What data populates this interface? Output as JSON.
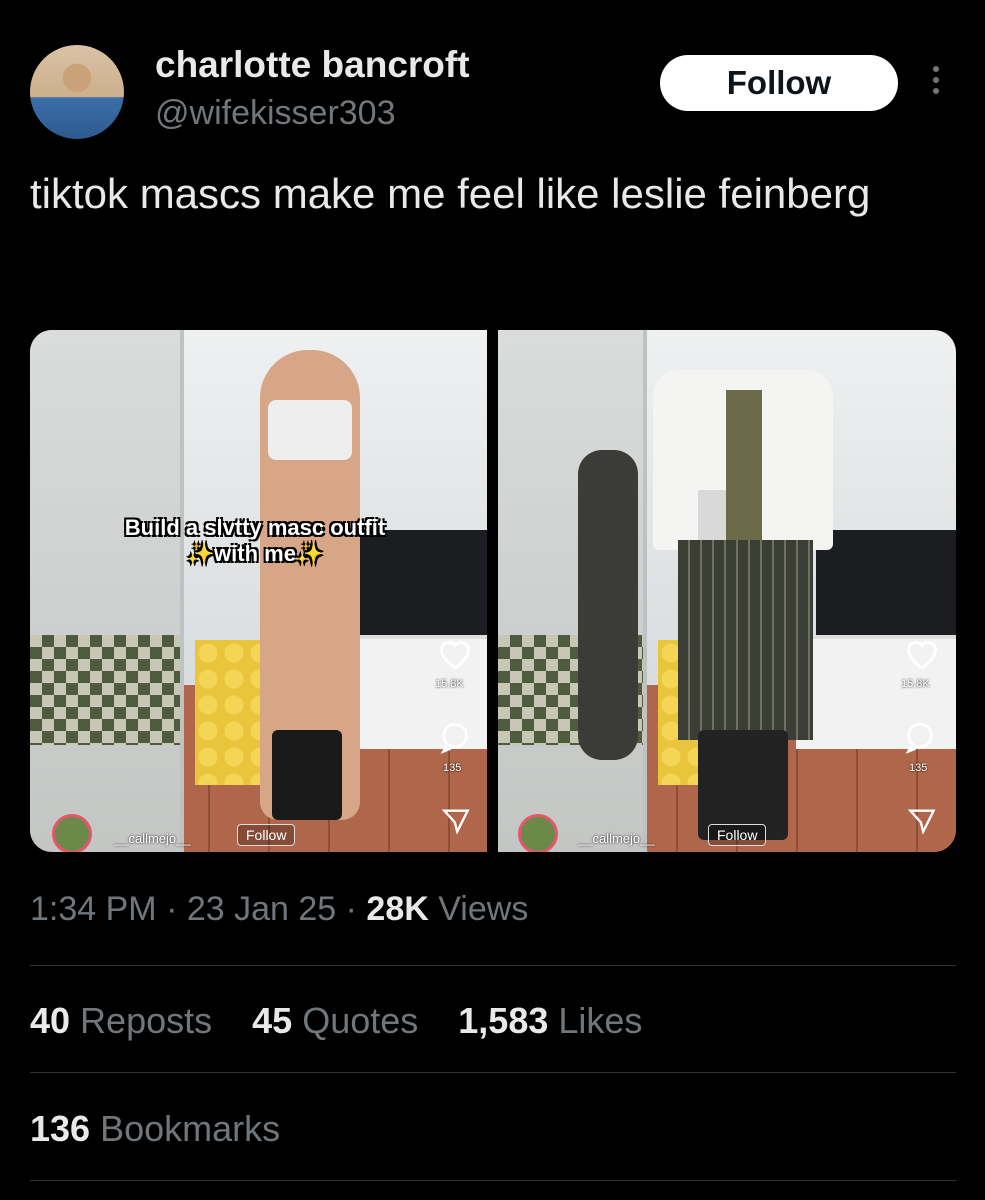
{
  "author": {
    "display_name": "charlotte bancroft",
    "handle": "@wifekisser303",
    "follow_label": "Follow"
  },
  "tweet": {
    "text": "tiktok mascs make me feel like leslie feinberg"
  },
  "media": [
    {
      "overlay_line1": "Build a slvtty masc outfit",
      "overlay_line2": "✨with me✨",
      "likes": "15.8K",
      "comments": "135",
      "username": "__callmejo__",
      "follow_label": "Follow"
    },
    {
      "likes": "15.8K",
      "comments": "135",
      "username": "__callmejo__",
      "follow_label": "Follow"
    }
  ],
  "meta": {
    "time": "1:34 PM",
    "sep1": " · ",
    "date": "23 Jan 25",
    "sep2": " · ",
    "views_count": "28K",
    "views_label": " Views"
  },
  "stats": {
    "reposts_count": "40",
    "reposts_label": " Reposts",
    "quotes_count": "45",
    "quotes_label": " Quotes",
    "likes_count": "1,583",
    "likes_label": " Likes",
    "bookmarks_count": "136",
    "bookmarks_label": " Bookmarks"
  },
  "colors": {
    "background": "#000000",
    "primary_text": "#e7e9ea",
    "secondary_text": "#71767b",
    "divider": "#2f3336"
  },
  "icons": [
    "more-icon",
    "tiktok-heart-icon",
    "tiktok-comment-icon",
    "tiktok-share-icon"
  ]
}
